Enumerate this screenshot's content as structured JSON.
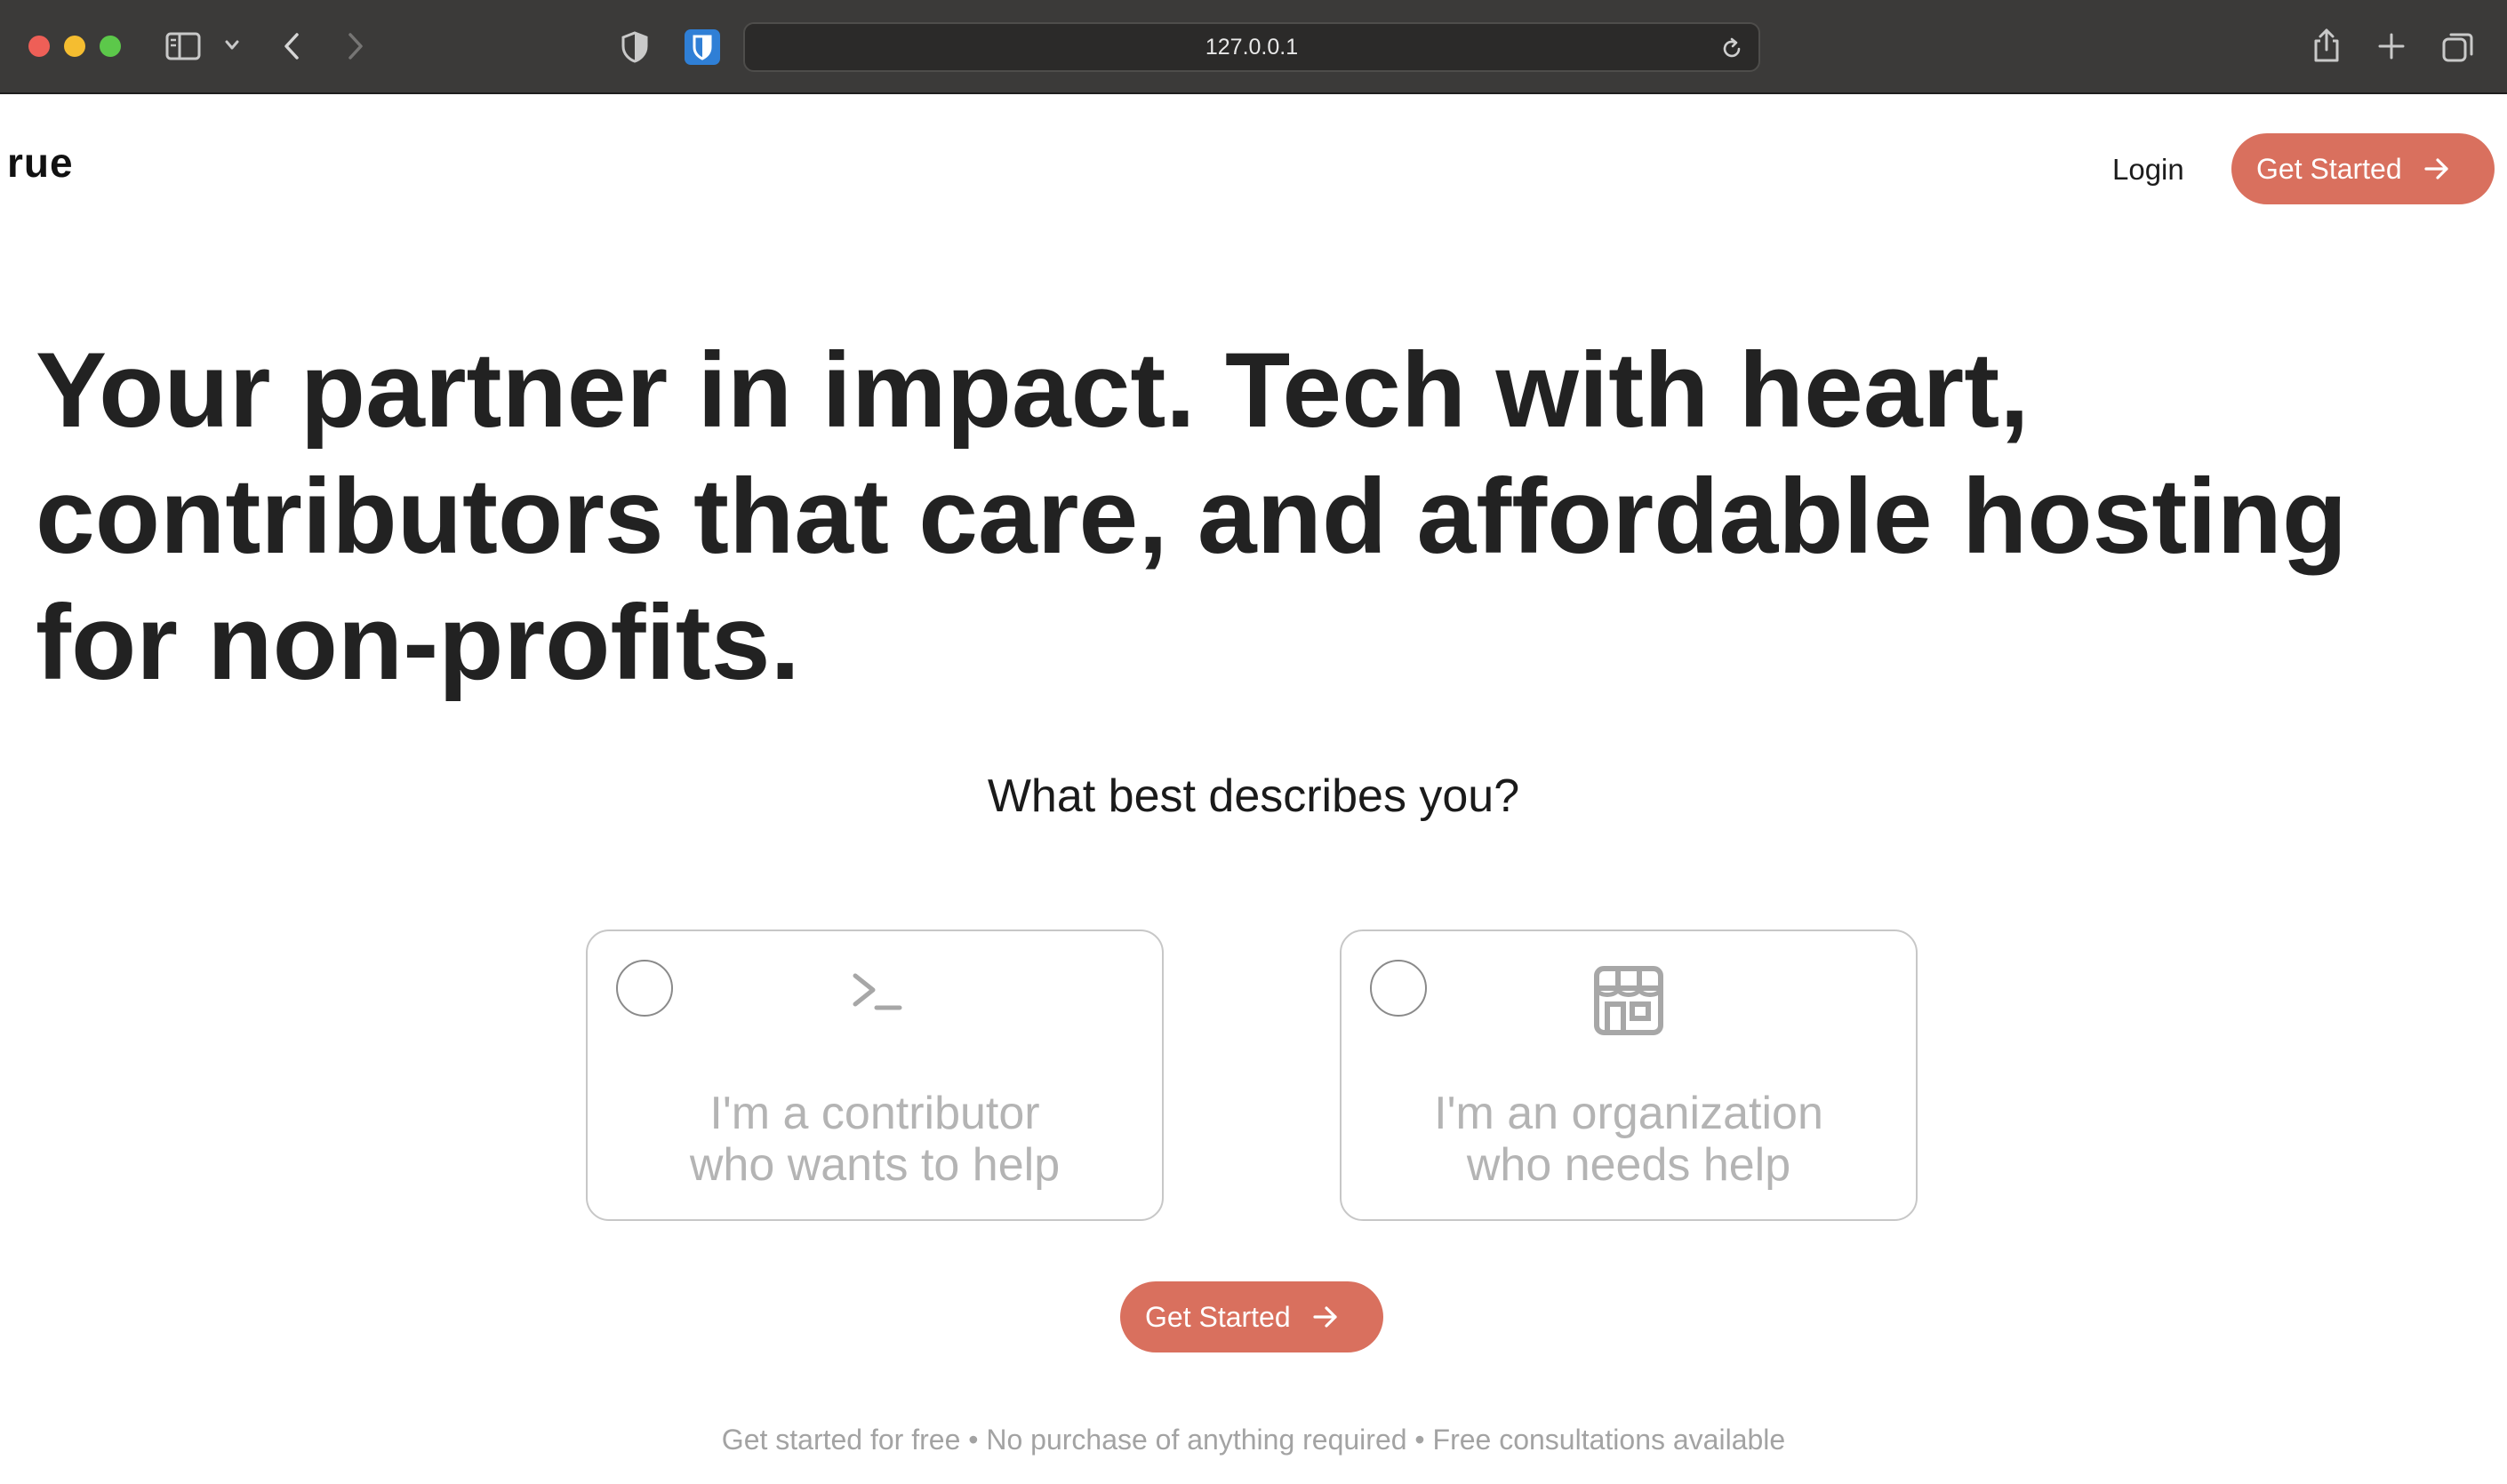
{
  "browser": {
    "address": "127.0.0.1",
    "icons": [
      "sidebar-icon",
      "chevron-down-icon",
      "back-icon",
      "forward-icon",
      "privacy-shield-icon",
      "bitwarden-icon",
      "reload-icon",
      "share-icon",
      "new-tab-icon",
      "tabs-overview-icon"
    ]
  },
  "header": {
    "logo": "rue",
    "login_label": "Login",
    "cta_label": "Get Started",
    "cta_icon": "arrow-right-icon"
  },
  "hero": {
    "headline": "Your partner in impact. Tech with heart, contributors that care, and affordable hosting for non-profits."
  },
  "chooser": {
    "question": "What best describes you?",
    "options": [
      {
        "icon": "terminal-icon",
        "line1": "I'm a contributor",
        "line2": "who wants to help",
        "selected": false
      },
      {
        "icon": "storefront-icon",
        "line1": "I'm an organization",
        "line2": "who needs help",
        "selected": false
      }
    ],
    "cta_label": "Get Started",
    "footnote": "Get started for free • No purchase of anything required • Free consultations available"
  },
  "colors": {
    "accent": "#d9705e",
    "chrome": "#3b3a39",
    "headline": "#222222",
    "muted_text": "#b4b4b4"
  }
}
